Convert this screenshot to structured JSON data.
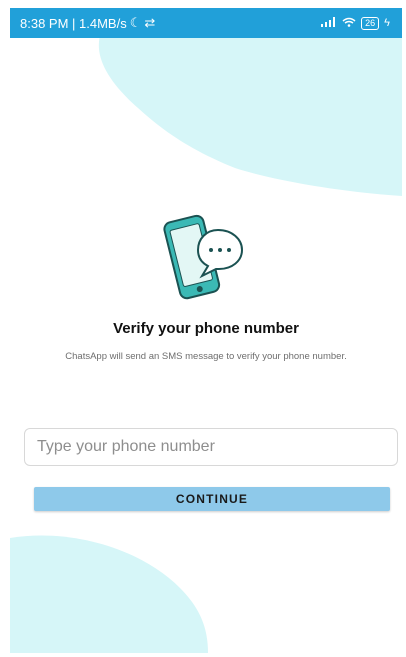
{
  "status_bar": {
    "time_network": "8:38 PM | 1.4MB/s",
    "signal_icon": "signal-bars-icon",
    "wifi_icon": "wifi-icon",
    "battery_level": "26",
    "charging_icon": "charging-bolt-icon"
  },
  "verify": {
    "title": "Verify your phone number",
    "subtitle": "ChatsApp will send an SMS message to verify your phone number.",
    "illustration_icon": "phone-chat-bubble-icon"
  },
  "phone_input": {
    "placeholder": "Type your phone number",
    "value": ""
  },
  "continue_label": "CONTINUE",
  "colors": {
    "status_bar": "#21a0d9",
    "blob": "#d6f6f8",
    "button": "#8ec9ea",
    "phone_body": "#3bb9b5"
  }
}
